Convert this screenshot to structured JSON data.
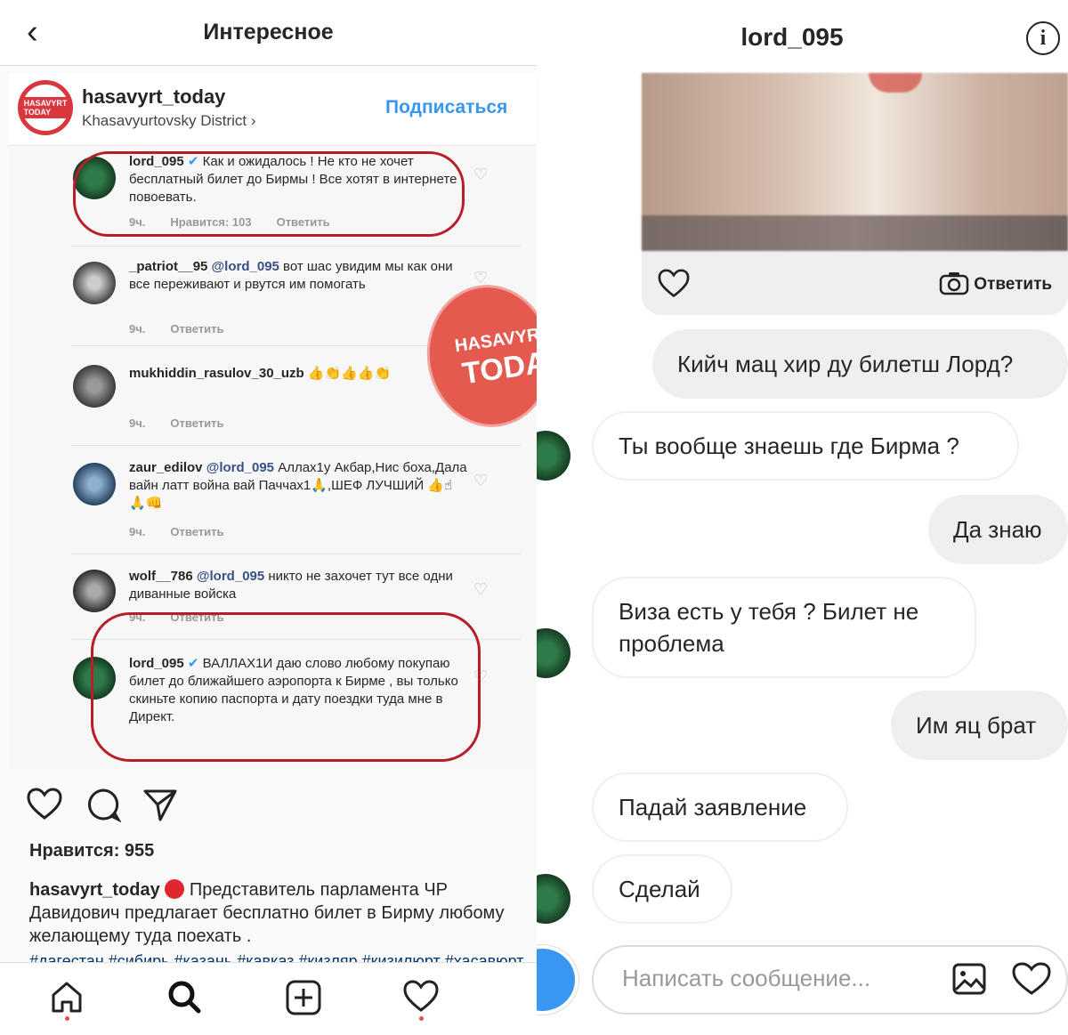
{
  "left": {
    "header_title": "Интересное",
    "account": {
      "avatar_text": "HASAVYRT TODAY",
      "name": "hasavyrt_today",
      "location": "Khasavyurtovsky District",
      "location_chevron": "›",
      "follow_label": "Подписаться"
    },
    "stamp": {
      "line1": "HASAVYRT",
      "line2": "TODAY"
    },
    "comments": [
      {
        "user": "lord_095",
        "verified": true,
        "mention": "",
        "text": "Как и ожидалось ! Не кто не хочет бесплатный  билет до Бирмы ! Все хотят в интернете повоевать.",
        "time": "9ч.",
        "likes": "Нравится: 103",
        "reply": "Ответить"
      },
      {
        "user": "_patriot__95",
        "verified": false,
        "mention": "@lord_095",
        "text": "вот шас увидим мы как они все переживают и рвутся им помогать",
        "time": "9ч.",
        "likes": "",
        "reply": "Ответить"
      },
      {
        "user": "mukhiddin_rasulov_30_uzb",
        "verified": false,
        "mention": "",
        "text": "👍👏👍👍👏",
        "time": "9ч.",
        "likes": "",
        "reply": "Ответить"
      },
      {
        "user": "zaur_edilov",
        "verified": false,
        "mention": "@lord_095",
        "text": "Аллах1у Акбар,Нис боха,Дала вайн латт война вай Паччах1🙏,ШЕФ ЛУЧШИЙ 👍☝🙏👊",
        "time": "9ч.",
        "likes": "",
        "reply": "Ответить"
      },
      {
        "user": "wolf__786",
        "verified": false,
        "mention": "@lord_095",
        "text": "никто не захочет тут все одни диванные войска",
        "time": "9ч.",
        "likes": "",
        "reply": "Ответить"
      },
      {
        "user": "lord_095",
        "verified": true,
        "mention": "",
        "text": "ВАЛЛАХ1И даю слово любому покупаю билет до ближайшего аэропорта к Бирме , вы только скиньте копию паспорта и дату поездки туда мне в Директ.",
        "time": "",
        "likes": "",
        "reply": ""
      }
    ],
    "likes_label": "Нравится: 955",
    "caption": {
      "user": "hasavyrt_today",
      "text": "Представитель парламента ЧР Давидович предлагает бесплатно билет в Бирму любому желающему туда поехать .",
      "hashtags": "#дагестан #сибирь #казань #кавказ #кизляр #кизилюрт #хасавюрт"
    },
    "icons": {
      "heart": "heart-icon",
      "comment": "comment-icon",
      "share": "share-icon",
      "home": "home-icon",
      "search": "search-icon",
      "add": "add-icon",
      "activity": "heart-icon"
    }
  },
  "right": {
    "header_title": "lord_095",
    "info_glyph": "i",
    "reply_label": "Ответить",
    "messages": [
      {
        "side": "out",
        "text": "Кийч мац хир ду билетш Лорд?"
      },
      {
        "side": "in",
        "text": "Ты вообще знаешь где Бирма ?"
      },
      {
        "side": "out",
        "text": "Да знаю"
      },
      {
        "side": "in",
        "text": "Виза есть у тебя ? Билет не проблема"
      },
      {
        "side": "out",
        "text": "Им яц брат"
      },
      {
        "side": "in",
        "text": "Падай заявление"
      },
      {
        "side": "in",
        "text": "Сделай"
      }
    ],
    "composer_placeholder": "Написать сообщение..."
  },
  "colors": {
    "accent_blue": "#3897f0",
    "annotation_red": "#b81e2a",
    "stamp_red": "#e45a4f"
  }
}
